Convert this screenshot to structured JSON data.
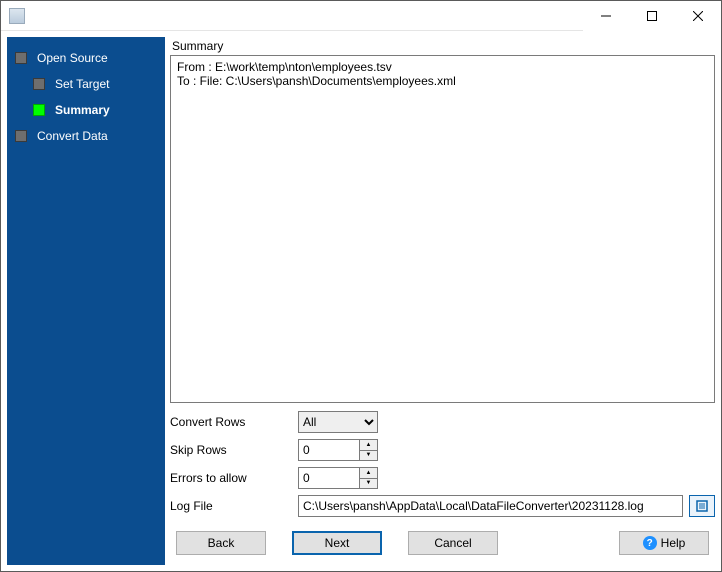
{
  "nav": {
    "items": [
      {
        "label": "Open Source",
        "active": false,
        "indent": false
      },
      {
        "label": "Set Target",
        "active": false,
        "indent": true
      },
      {
        "label": "Summary",
        "active": true,
        "indent": true
      },
      {
        "label": "Convert Data",
        "active": false,
        "indent": false
      }
    ]
  },
  "summary": {
    "title": "Summary",
    "from_line": "From : E:\\work\\temp\\nton\\employees.tsv",
    "to_line": "To : File: C:\\Users\\pansh\\Documents\\employees.xml"
  },
  "options": {
    "convert_rows_label": "Convert Rows",
    "convert_rows_value": "All",
    "skip_rows_label": "Skip Rows",
    "skip_rows_value": "0",
    "errors_label": "Errors to allow",
    "errors_value": "0",
    "log_label": "Log File",
    "log_value": "C:\\Users\\pansh\\AppData\\Local\\DataFileConverter\\20231128.log"
  },
  "buttons": {
    "back": "Back",
    "next": "Next",
    "cancel": "Cancel",
    "help": "Help"
  }
}
